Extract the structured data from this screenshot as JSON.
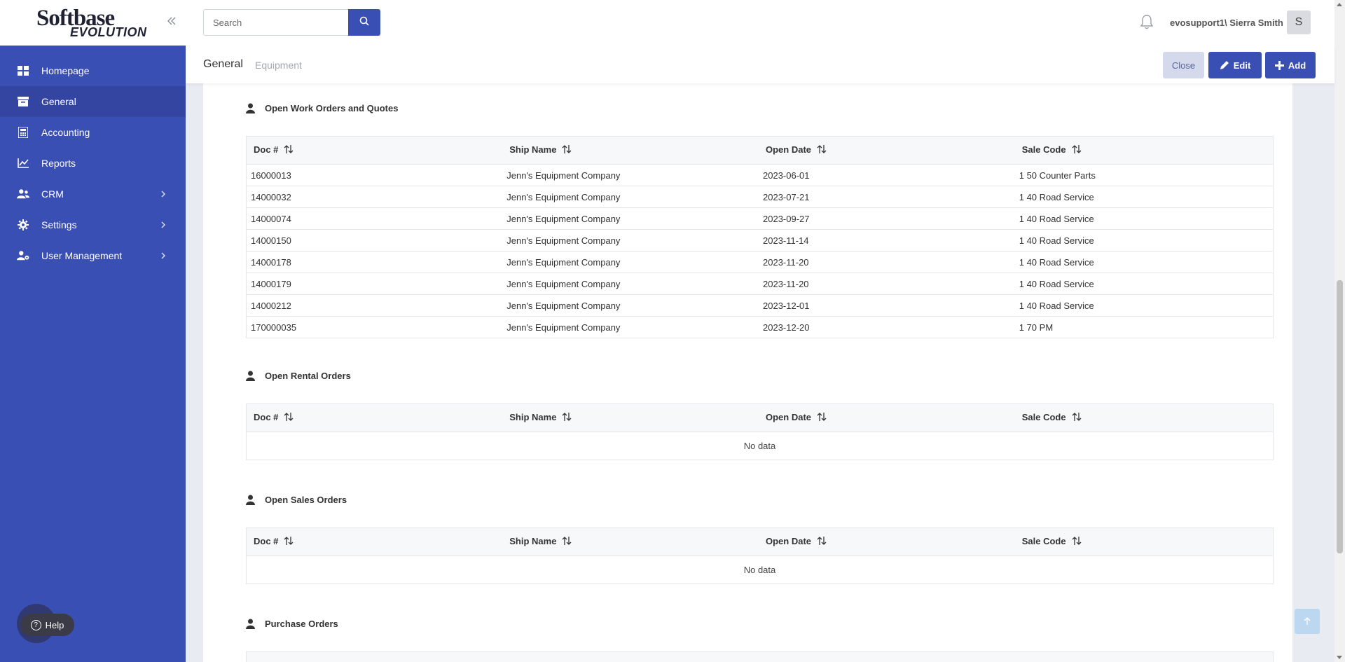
{
  "app": {
    "logo_top": "Softbase",
    "logo_bottom": "EVOLUTION"
  },
  "sidebar": {
    "items": [
      {
        "label": "Homepage",
        "icon": "grid-icon",
        "active": false,
        "has_children": false
      },
      {
        "label": "General",
        "icon": "archive-box-icon",
        "active": true,
        "has_children": false
      },
      {
        "label": "Accounting",
        "icon": "calculator-icon",
        "active": false,
        "has_children": false
      },
      {
        "label": "Reports",
        "icon": "chart-line-icon",
        "active": false,
        "has_children": false
      },
      {
        "label": "CRM",
        "icon": "users-icon",
        "active": false,
        "has_children": true
      },
      {
        "label": "Settings",
        "icon": "gear-icon",
        "active": false,
        "has_children": true
      },
      {
        "label": "User Management",
        "icon": "user-gear-icon",
        "active": false,
        "has_children": true
      }
    ],
    "help_label": "Help"
  },
  "topbar": {
    "search_placeholder": "Search",
    "username": "evosupport1\\ Sierra Smith",
    "avatar_letter": "S"
  },
  "subbar": {
    "crumb_main": "General",
    "crumb_sub": "Equipment",
    "close_label": "Close",
    "edit_label": "Edit",
    "add_label": "Add"
  },
  "sections": {
    "work_orders": {
      "title": "Open Work Orders and Quotes",
      "columns": [
        "Doc #",
        "Ship Name",
        "Open Date",
        "Sale Code"
      ],
      "rows": [
        [
          "16000013",
          "Jenn's Equipment Company",
          "2023-06-01",
          "1 50 Counter Parts"
        ],
        [
          "14000032",
          "Jenn's Equipment Company",
          "2023-07-21",
          "1 40 Road Service"
        ],
        [
          "14000074",
          "Jenn's Equipment Company",
          "2023-09-27",
          "1 40 Road Service"
        ],
        [
          "14000150",
          "Jenn's Equipment Company",
          "2023-11-14",
          "1 40 Road Service"
        ],
        [
          "14000178",
          "Jenn's Equipment Company",
          "2023-11-20",
          "1 40 Road Service"
        ],
        [
          "14000179",
          "Jenn's Equipment Company",
          "2023-11-20",
          "1 40 Road Service"
        ],
        [
          "14000212",
          "Jenn's Equipment Company",
          "2023-12-01",
          "1 40 Road Service"
        ],
        [
          "170000035",
          "Jenn's Equipment Company",
          "2023-12-20",
          "1 70 PM"
        ]
      ]
    },
    "rental_orders": {
      "title": "Open Rental Orders",
      "columns": [
        "Doc #",
        "Ship Name",
        "Open Date",
        "Sale Code"
      ],
      "empty_text": "No data"
    },
    "sales_orders": {
      "title": "Open Sales Orders",
      "columns": [
        "Doc #",
        "Ship Name",
        "Open Date",
        "Sale Code"
      ],
      "empty_text": "No data"
    },
    "purchase_orders": {
      "title": "Purchase Orders"
    }
  },
  "colors": {
    "sidebar_bg": "#3a4fb3",
    "sidebar_active": "#3345a1",
    "primary": "#3a4fb3",
    "close_btn_bg": "#d5d9ec"
  }
}
